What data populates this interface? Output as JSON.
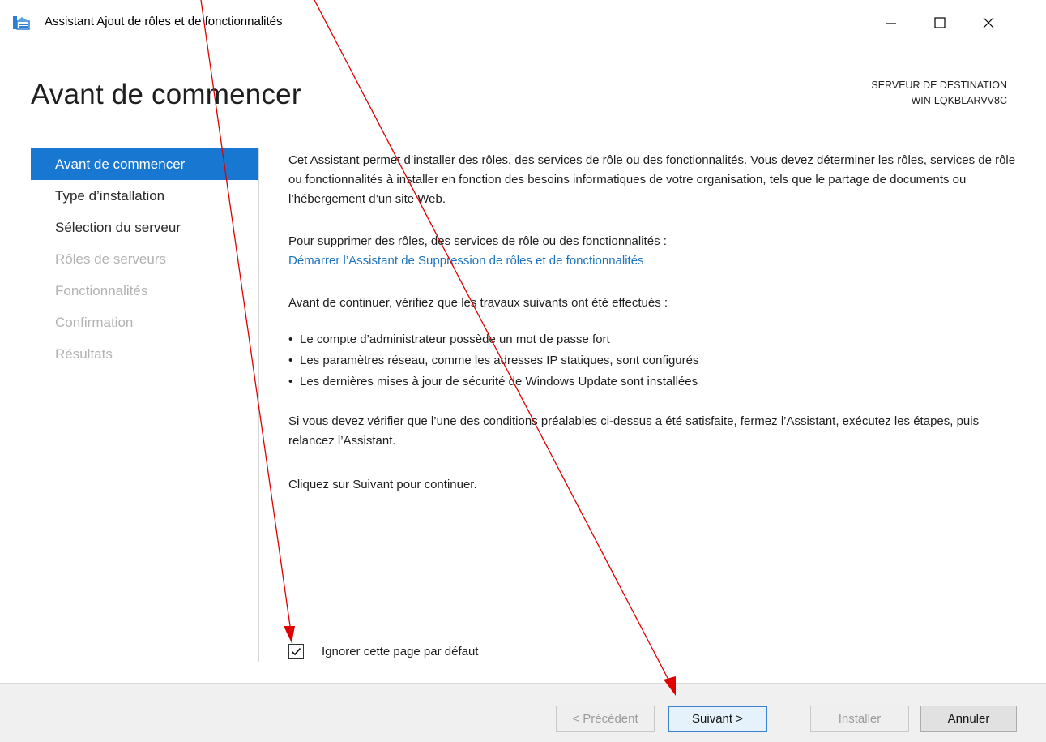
{
  "window": {
    "title": "Assistant Ajout de rôles et de fonctionnalités"
  },
  "header": {
    "title": "Avant de commencer",
    "destination_label": "SERVEUR DE DESTINATION",
    "destination_server": "WIN-LQKBLARVV8C"
  },
  "sidebar": {
    "items": [
      {
        "label": "Avant de commencer",
        "state": "active"
      },
      {
        "label": "Type d’installation",
        "state": "enabled"
      },
      {
        "label": "Sélection du serveur",
        "state": "enabled"
      },
      {
        "label": "Rôles de serveurs",
        "state": "disabled"
      },
      {
        "label": "Fonctionnalités",
        "state": "disabled"
      },
      {
        "label": "Confirmation",
        "state": "disabled"
      },
      {
        "label": "Résultats",
        "state": "disabled"
      }
    ]
  },
  "content": {
    "intro": "Cet Assistant permet d’installer des rôles, des services de rôle ou des fonctionnalités. Vous devez déterminer les rôles, services de rôle ou fonctionnalités à installer en fonction des besoins informatiques de votre organisation, tels que le partage de documents ou l’hébergement d’un site Web.",
    "remove_text": "Pour supprimer des rôles, des services de rôle ou des fonctionnalités :",
    "remove_link": "Démarrer l’Assistant de Suppression de rôles et de fonctionnalités",
    "before_continue": "Avant de continuer, vérifiez que les travaux suivants ont été effectués :",
    "bullets": [
      "Le compte d’administrateur possède un mot de passe fort",
      "Les paramètres réseau, comme les adresses IP statiques, sont configurés",
      "Les dernières mises à jour de sécurité de Windows Update sont installées"
    ],
    "prereq_note": "Si vous devez vérifier que l’une des conditions préalables ci-dessus a été satisfaite, fermez l’Assistant, exécutez les étapes, puis relancez l’Assistant.",
    "click_next": "Cliquez sur Suivant pour continuer."
  },
  "skip_checkbox": {
    "label": "Ignorer cette page par défaut",
    "checked": true
  },
  "footer": {
    "prev_label": "< Précédent",
    "next_label": "Suivant >",
    "install_label": "Installer",
    "cancel_label": "Annuler"
  },
  "colors": {
    "accent": "#1777d1",
    "link": "#1f74bf",
    "annotation_arrow": "#e00000"
  },
  "annotations": {
    "arrow_count": 2
  }
}
